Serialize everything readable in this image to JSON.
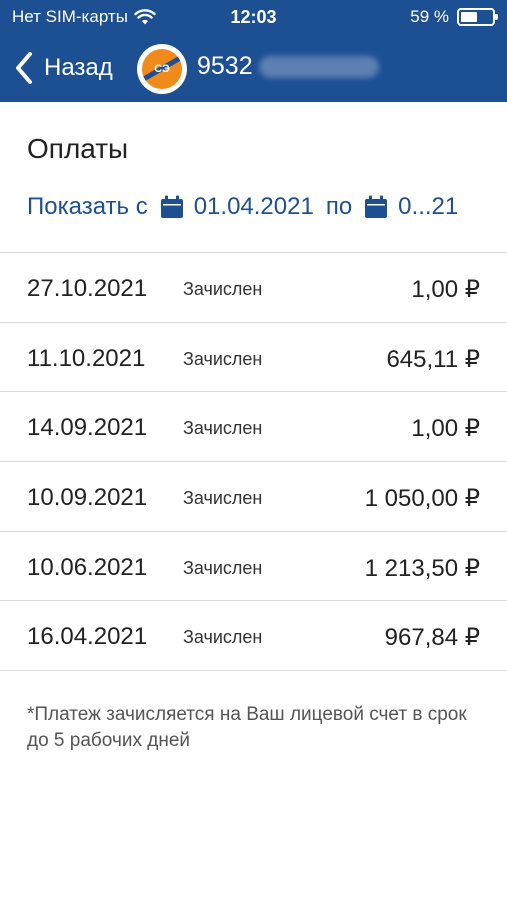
{
  "status_bar": {
    "carrier": "Нет SIM-карты",
    "time": "12:03",
    "battery_text": "59 %",
    "battery_level": 0.59
  },
  "nav": {
    "back_label": "Назад",
    "logo_text": "СЭ",
    "account_number": "9532"
  },
  "page": {
    "title": "Оплаты",
    "filter_prefix": "Показать с",
    "date_from": "01.04.2021",
    "filter_mid": "по",
    "date_to": "0...21"
  },
  "payments": [
    {
      "date": "27.10.2021",
      "status": "Зачислен",
      "amount": "1,00 ₽"
    },
    {
      "date": "11.10.2021",
      "status": "Зачислен",
      "amount": "645,11 ₽"
    },
    {
      "date": "14.09.2021",
      "status": "Зачислен",
      "amount": "1,00 ₽"
    },
    {
      "date": "10.09.2021",
      "status": "Зачислен",
      "amount": "1 050,00 ₽"
    },
    {
      "date": "10.06.2021",
      "status": "Зачислен",
      "amount": "1 213,50 ₽"
    },
    {
      "date": "16.04.2021",
      "status": "Зачислен",
      "amount": "967,84 ₽"
    }
  ],
  "footnote": "*Платеж зачисляется на Ваш лицевой счет в срок до 5 рабочих дней",
  "colors": {
    "brand": "#1d4f93",
    "logo_accent": "#f08a1c"
  }
}
